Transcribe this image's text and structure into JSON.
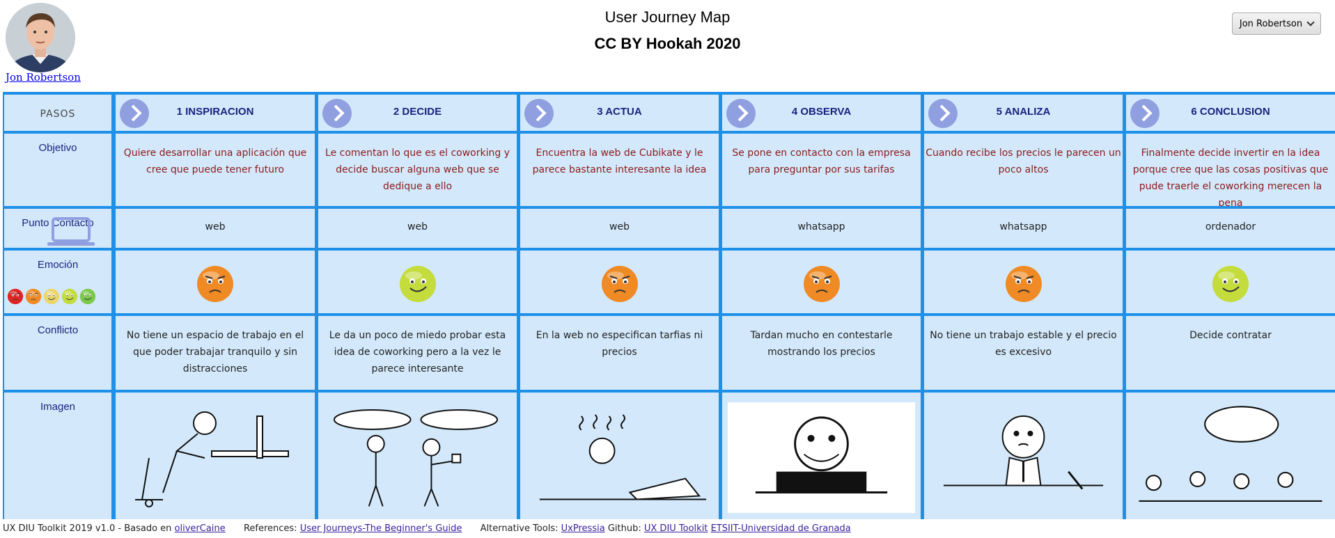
{
  "header": {
    "user_name": "Jon Robertson",
    "title": "User Journey Map",
    "subtitle": "CC BY Hookah 2020",
    "user_menu_label": "Jon Robertson"
  },
  "rows": {
    "pasos": "PASOS",
    "objetivo": "Objetivo",
    "punto_contacto": "Punto Contacto",
    "emocion": "Emoción",
    "conflicto": "Conflicto",
    "imagen": "Imagen"
  },
  "steps": [
    {
      "title": "1 INSPIRACION",
      "objetivo": "Quiere desarrollar una aplicación que cree que puede tener futuro",
      "contacto": "web",
      "emotion": "angry",
      "conflicto": "No tiene un espacio de trabajo en el que poder trabajar tranquilo y sin distracciones"
    },
    {
      "title": "2 DECIDE",
      "objetivo": "Le comentan lo que es el coworking y decide buscar alguna web que se dedique a ello",
      "contacto": "web",
      "emotion": "happy",
      "conflicto": "Le da un poco de miedo probar esta idea de coworking pero a la vez le parece interesante"
    },
    {
      "title": "3 ACTUA",
      "objetivo": "Encuentra la web de Cubikate y le parece bastante interesante la idea",
      "contacto": "web",
      "emotion": "angry",
      "conflicto": "En la web no especifican tarfias ni precios"
    },
    {
      "title": "4 OBSERVA",
      "objetivo": "Se pone en contacto con la empresa para preguntar por sus tarifas",
      "contacto": "whatsapp",
      "emotion": "angry",
      "conflicto": "Tardan mucho en contestarle mostrando los precios"
    },
    {
      "title": "5 ANALIZA",
      "objetivo": "Cuando recibe los precios le parecen un poco altos",
      "contacto": "whatsapp",
      "emotion": "angry",
      "conflicto": "No tiene un trabajo estable y el precio es excesivo"
    },
    {
      "title": "6 CONCLUSION",
      "objetivo": "Finalmente decide invertir en la idea porque cree que las cosas positivas que pude traerle el coworking merecen la pena",
      "contacto": "ordenador",
      "emotion": "happy",
      "conflicto": "Decide contratar"
    }
  ],
  "colors": {
    "grid_border": "#1e90e8",
    "cell_bg": "#d3e9fb",
    "label_text": "#1a237e",
    "objective_text": "#8b1a1a",
    "angry_face": "#f08a24",
    "happy_face": "#c4dc3c"
  },
  "icons": [
    "chevron-right-icon",
    "laptop-icon",
    "emotion-scale-icon",
    "angry-face-icon",
    "happy-face-icon",
    "chevron-down-icon"
  ],
  "footer": {
    "prefix": "UX DIU Toolkit 2019 v1.0 - Basado en",
    "link_olivercaine": "oliverCaine",
    "references_label": "References:",
    "link_references": "User Journeys-The Beginner's Guide",
    "alt_tools_label": "Alternative Tools:",
    "link_uxpressia": "UxPressia",
    "github_label": "Github:",
    "link_github": "UX DIU Toolkit",
    "link_etsiit": "ETSIIT-Universidad de Granada"
  }
}
